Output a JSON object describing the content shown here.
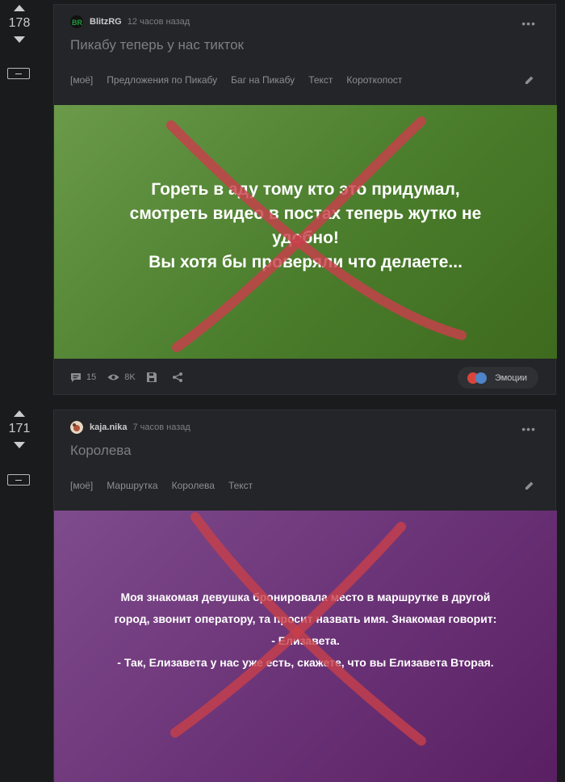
{
  "posts": [
    {
      "rating": "178",
      "author": "BlitzRG",
      "time": "12 часов назад",
      "title": "Пикабу теперь у нас тикток",
      "tags": [
        "[моё]",
        "Предложения по Пикабу",
        "Баг на Пикабу",
        "Текст",
        "Короткопост"
      ],
      "media_lines": [
        "Гореть в аду тому кто это придумал,",
        "смотреть видео в постах теперь жутко не",
        "удобно!",
        "Вы хотя бы проверяли что делаете..."
      ],
      "comments": "15",
      "views": "8K",
      "emotions_label": "Эмоции",
      "media_colors": [
        "#6a9a4a",
        "#3e6a1e"
      ]
    },
    {
      "rating": "171",
      "author": "kaja.nika",
      "time": "7 часов назад",
      "title": "Королева",
      "tags": [
        "[моё]",
        "Маршрутка",
        "Королева",
        "Текст"
      ],
      "media_lines": [
        "Моя знакомая девушка бронировала место в маршрутке в другой",
        "город, звонит оператору, та просит назвать имя. Знакомая говорит:",
        "- Елизавета.",
        "- Так, Елизавета у нас уже есть, скажете, что вы Елизавета Вторая."
      ],
      "media_colors": [
        "#7e4b8c",
        "#5a1f63"
      ]
    }
  ],
  "colors": {
    "cross": "#c8404a",
    "accent_green": "#1f9d3c"
  }
}
